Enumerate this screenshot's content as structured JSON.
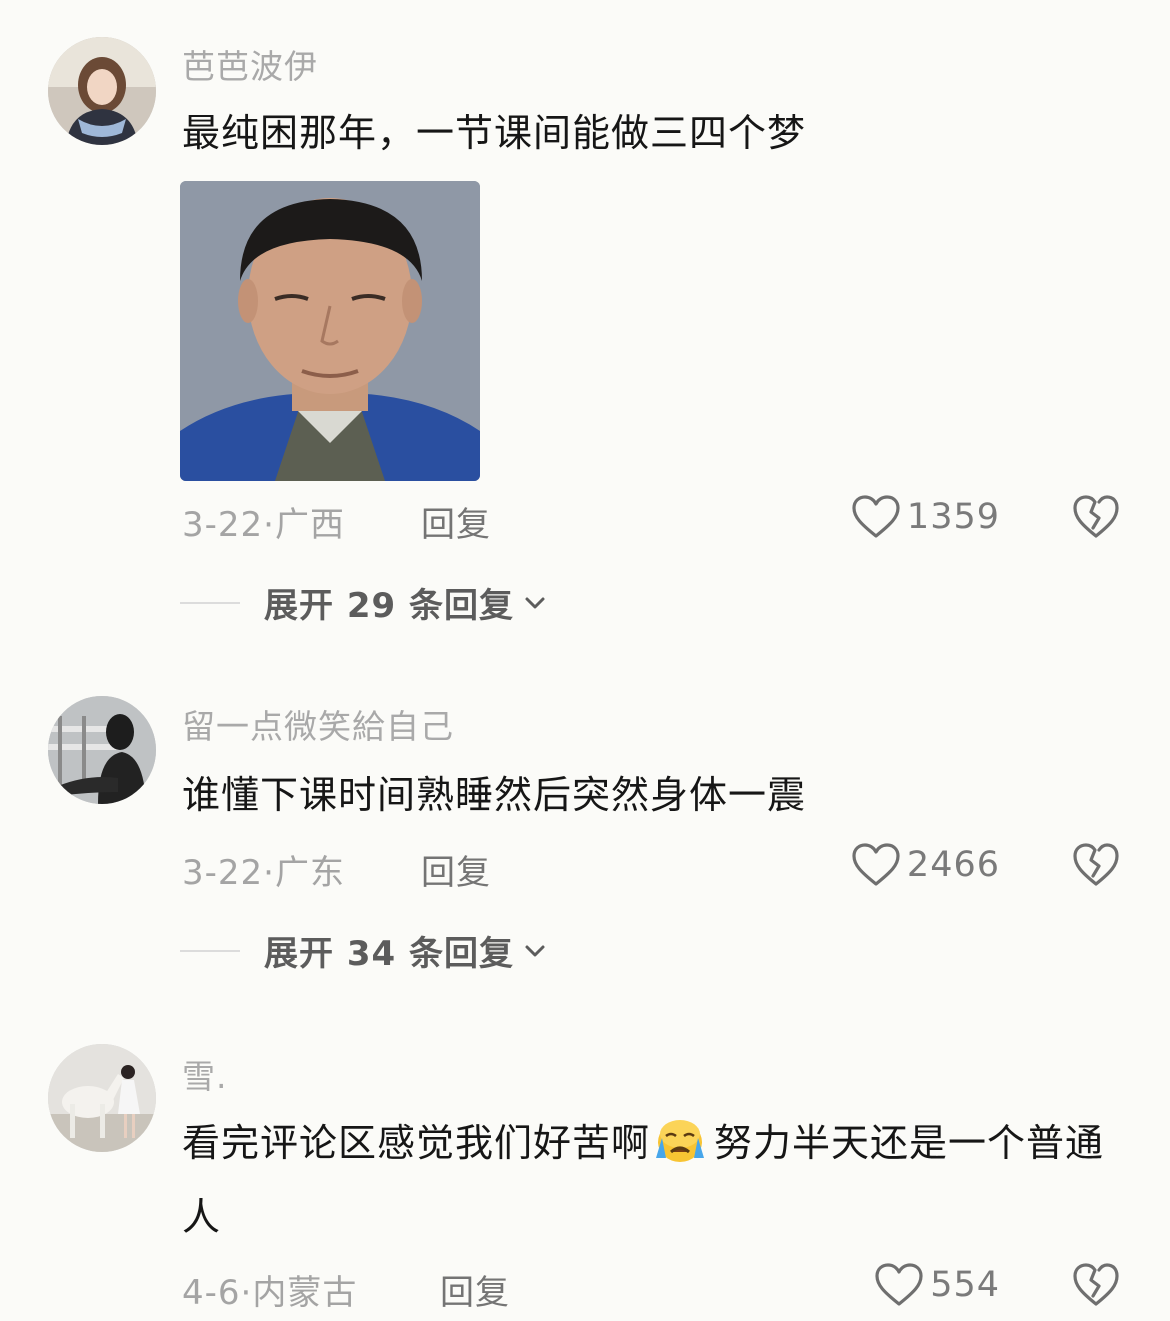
{
  "comments": [
    {
      "username": "芭芭波伊",
      "text": "最纯困那年，一节课间能做三四个梦",
      "meta": "3-22·广西",
      "reply_label": "回复",
      "likes": "1359",
      "expand_label": "展开 29 条回复"
    },
    {
      "username": "留一点微笑給自己",
      "text": "谁懂下课时间熟睡然后突然身体一震",
      "meta": "3-22·广东",
      "reply_label": "回复",
      "likes": "2466",
      "expand_label": "展开 34 条回复"
    },
    {
      "username": "雪.",
      "text_before_emoji": "看完评论区感觉我们好苦啊",
      "emoji": "crying-face-emoji",
      "text_after_emoji": "努力半天还是一个普通人",
      "meta": "4-6·内蒙古",
      "reply_label": "回复",
      "likes": "554"
    }
  ],
  "icons": {
    "like": "heart-outline-icon",
    "dislike": "broken-heart-outline-icon",
    "expand": "chevron-down-icon"
  },
  "colors": {
    "background": "#fbfbf8",
    "username": "#a9a9a9",
    "text": "#161616",
    "meta": "#a4a4a4"
  }
}
